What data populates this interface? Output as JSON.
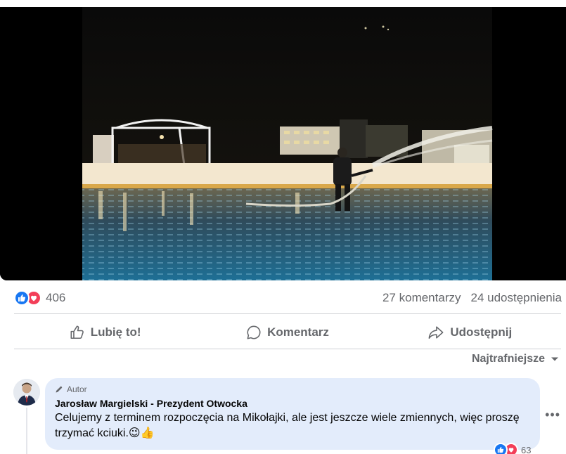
{
  "post": {
    "photo": {
      "description_icon": "ice-rink-photo"
    },
    "reactions": {
      "count": "406",
      "icons": [
        "like-icon",
        "love-icon"
      ]
    },
    "stats": {
      "comments": "27 komentarzy",
      "shares": "24 udostępnienia"
    },
    "actions": {
      "like_label": "Lubię to!",
      "comment_label": "Komentarz",
      "share_label": "Udostępnij"
    },
    "sort_label": "Najtrafniejsze"
  },
  "comment": {
    "badge_label": "Autor",
    "author": "Jarosław Margielski - Prezydent Otwocka",
    "text": "Celujemy z terminem rozpoczęcia na Mikołajki, ale jest jeszcze wiele zmiennych, więc proszę trzymać kciuki.😉👍",
    "reaction_count": "63"
  },
  "colors": {
    "accent": "#1877f2",
    "love": "#f33e58",
    "bubble": "#e3ecfb",
    "muted": "#65676b"
  }
}
